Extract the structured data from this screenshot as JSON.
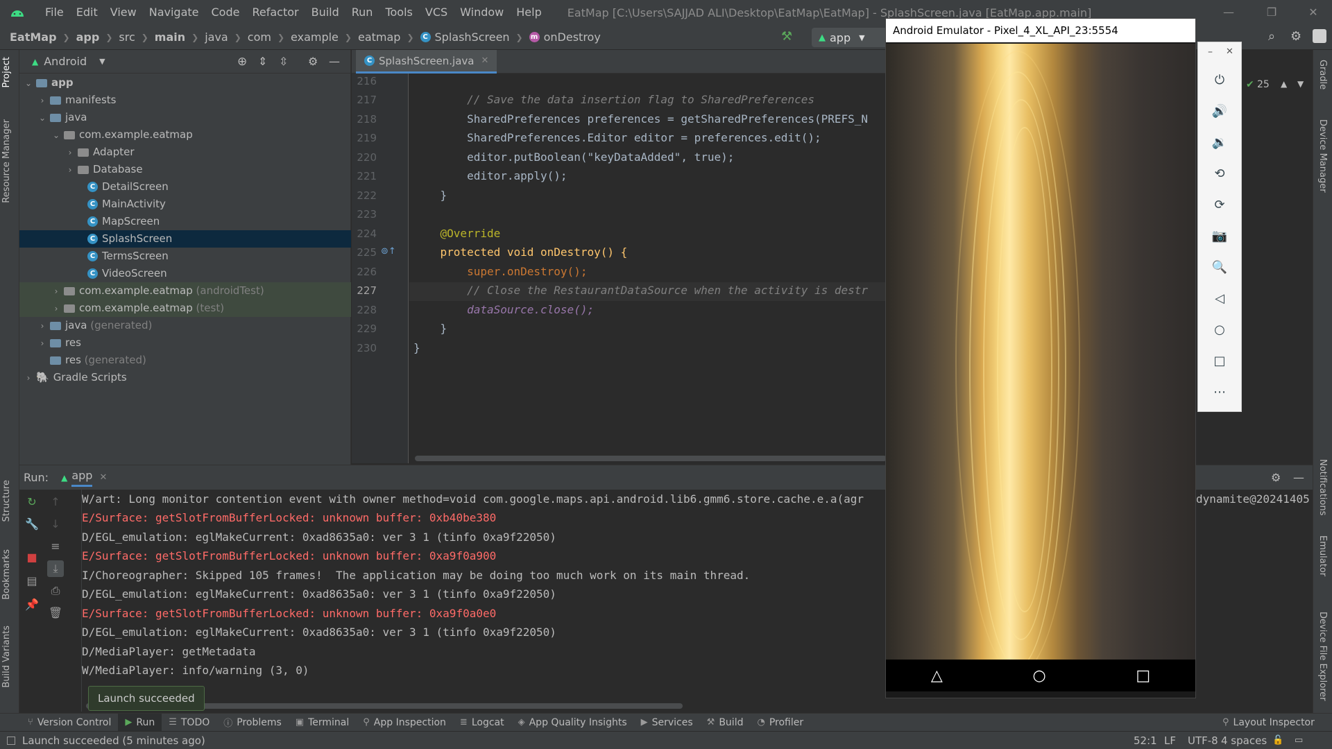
{
  "window": {
    "title": "EatMap [C:\\Users\\SAJJAD ALI\\Desktop\\EatMap\\EatMap] - SplashScreen.java [EatMap.app.main]",
    "menu": [
      "File",
      "Edit",
      "View",
      "Navigate",
      "Code",
      "Refactor",
      "Build",
      "Run",
      "Tools",
      "VCS",
      "Window",
      "Help"
    ]
  },
  "breadcrumbs": [
    "EatMap",
    "app",
    "src",
    "main",
    "java",
    "com",
    "example",
    "eatmap",
    "SplashScreen",
    "onDestroy"
  ],
  "run_config": "app",
  "project": {
    "view": "Android",
    "tree": [
      {
        "label": "app",
        "suffix": ""
      },
      {
        "label": "manifests",
        "suffix": ""
      },
      {
        "label": "java",
        "suffix": ""
      },
      {
        "label": "com.example.eatmap",
        "suffix": ""
      },
      {
        "label": "Adapter",
        "suffix": ""
      },
      {
        "label": "Database",
        "suffix": ""
      },
      {
        "label": "DetailScreen",
        "suffix": ""
      },
      {
        "label": "MainActivity",
        "suffix": ""
      },
      {
        "label": "MapScreen",
        "suffix": ""
      },
      {
        "label": "SplashScreen",
        "suffix": ""
      },
      {
        "label": "TermsScreen",
        "suffix": ""
      },
      {
        "label": "VideoScreen",
        "suffix": ""
      },
      {
        "label": "com.example.eatmap",
        "suffix": "(androidTest)"
      },
      {
        "label": "com.example.eatmap",
        "suffix": "(test)"
      },
      {
        "label": "java",
        "suffix": "(generated)"
      },
      {
        "label": "res",
        "suffix": ""
      },
      {
        "label": "res",
        "suffix": "(generated)"
      },
      {
        "label": "Gradle Scripts",
        "suffix": ""
      }
    ]
  },
  "editor": {
    "tab": "SplashScreen.java",
    "warnings_count": "25",
    "line_numbers": [
      "216",
      "217",
      "218",
      "219",
      "220",
      "221",
      "222",
      "223",
      "224",
      "225",
      "226",
      "227",
      "228",
      "229",
      "230"
    ],
    "code": [
      "",
      "        // Save the data insertion flag to SharedPreferences",
      "        SharedPreferences preferences = getSharedPreferences(PREFS_N",
      "        SharedPreferences.Editor editor = preferences.edit();",
      "        editor.putBoolean(\"keyDataAdded\", true);",
      "        editor.apply();",
      "    }",
      "",
      "    @Override",
      "    protected void onDestroy() {",
      "        super.onDestroy();",
      "        // Close the RestaurantDataSource when the activity is destr",
      "        dataSource.close();",
      "    }",
      "}"
    ]
  },
  "emulator": {
    "title": "Android Emulator - Pixel_4_XL_API_23:5554",
    "controls": [
      "power-icon",
      "volume-up-icon",
      "volume-down-icon",
      "rotate-left-icon",
      "rotate-right-icon",
      "camera-icon",
      "zoom-icon",
      "back-icon",
      "home-icon",
      "overview-icon",
      "more-icon"
    ]
  },
  "run_panel": {
    "label": "Run:",
    "tab": "app",
    "log_tail": "dynamite@20241405",
    "logs": [
      {
        "level": "info",
        "text": "W/art: Long monitor contention event with owner method=void com.google.maps.api.android.lib6.gmm6.store.cache.e.a(agr"
      },
      {
        "level": "error",
        "text": "E/Surface: getSlotFromBufferLocked: unknown buffer: 0xb40be380"
      },
      {
        "level": "info",
        "text": "D/EGL_emulation: eglMakeCurrent: 0xad8635a0: ver 3 1 (tinfo 0xa9f22050)"
      },
      {
        "level": "error",
        "text": "E/Surface: getSlotFromBufferLocked: unknown buffer: 0xa9f0a900"
      },
      {
        "level": "info",
        "text": "I/Choreographer: Skipped 105 frames!  The application may be doing too much work on its main thread."
      },
      {
        "level": "info",
        "text": "D/EGL_emulation: eglMakeCurrent: 0xad8635a0: ver 3 1 (tinfo 0xa9f22050)"
      },
      {
        "level": "error",
        "text": "E/Surface: getSlotFromBufferLocked: unknown buffer: 0xa9f0a0e0"
      },
      {
        "level": "info",
        "text": "D/EGL_emulation: eglMakeCurrent: 0xad8635a0: ver 3 1 (tinfo 0xa9f22050)"
      },
      {
        "level": "info",
        "text": "D/MediaPlayer: getMetadata"
      },
      {
        "level": "info",
        "text": "W/MediaPlayer: info/warning (3, 0)"
      }
    ],
    "toast": "Launch succeeded"
  },
  "bottom_tools": [
    "Version Control",
    "Run",
    "TODO",
    "Problems",
    "Terminal",
    "App Inspection",
    "Logcat",
    "App Quality Insights",
    "Services",
    "Build",
    "Profiler"
  ],
  "layout_inspector": "Layout Inspector",
  "left_tabs": [
    "Project",
    "Resource Manager",
    "Structure",
    "Bookmarks",
    "Build Variants"
  ],
  "right_tabs": [
    "Gradle",
    "Device Manager",
    "Notifications",
    "Emulator",
    "Device File Explorer"
  ],
  "status": {
    "message": "Launch succeeded (5 minutes ago)",
    "position": "52:1",
    "line_sep": "LF",
    "encoding": "UTF-8",
    "indent": "4 spaces"
  },
  "colors": {
    "error": "#ff6b68",
    "selection": "#0d293e",
    "accent": "#3592c4"
  }
}
